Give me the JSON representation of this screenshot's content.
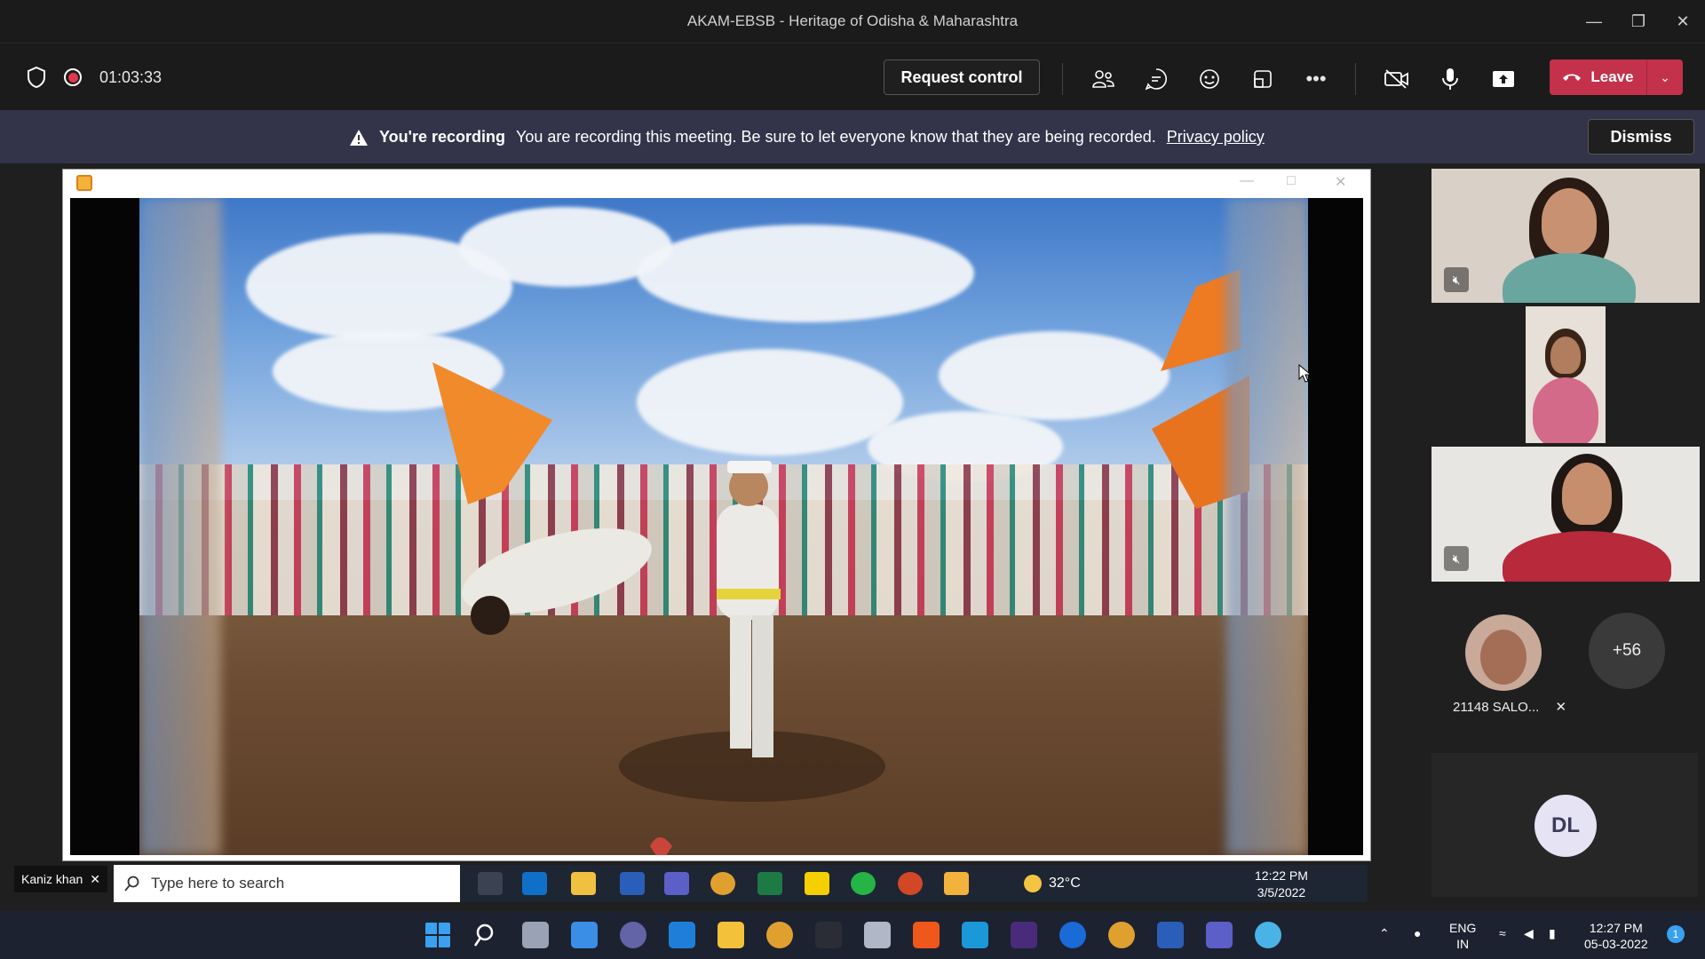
{
  "window": {
    "title": "AKAM-EBSB - Heritage of Odisha & Maharashtra",
    "controls": [
      "minimize",
      "restore",
      "close"
    ]
  },
  "toolbar": {
    "timer": "01:03:33",
    "request_control": "Request control",
    "leave_label": "Leave",
    "icons": [
      "people-icon",
      "chat-icon",
      "reactions-icon",
      "rooms-icon",
      "more-icon",
      "camera-off-icon",
      "mic-icon",
      "share-icon"
    ]
  },
  "banner": {
    "strong": "You're recording",
    "message": "You are recording this meeting. Be sure to let everyone know that they are being recorded.",
    "link": "Privacy policy",
    "dismiss": "Dismiss"
  },
  "speaker": {
    "name": "Kaniz khan"
  },
  "participants": {
    "name_label": "21148 SALO...",
    "overflow": "+56",
    "initials": "DL"
  },
  "shared_taskbar": {
    "search_placeholder": "Type here to search",
    "weather": "32°C",
    "time": "12:22 PM",
    "date": "3/5/2022"
  },
  "taskbar": {
    "lang": "ENG",
    "region": "IN",
    "time": "12:27 PM",
    "date": "05-03-2022",
    "notifications": "1"
  },
  "colors": {
    "leave": "#c4314b",
    "banner": "#33344a",
    "record": "#e0394a"
  }
}
